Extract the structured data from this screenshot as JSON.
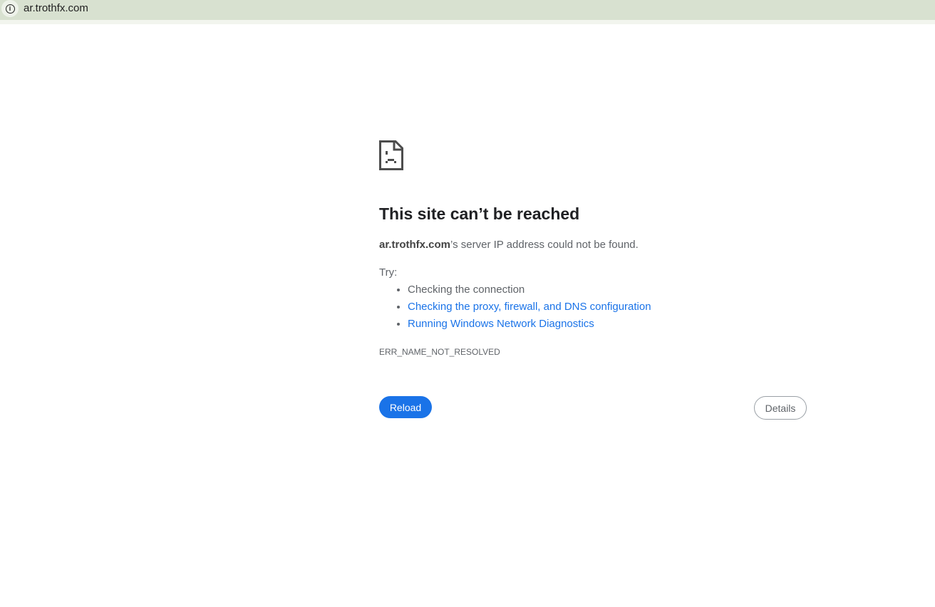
{
  "address_bar": {
    "url": "ar.trothfx.com",
    "icon": "info-icon"
  },
  "error": {
    "title": "This site can’t be reached",
    "host": "ar.trothfx.com",
    "message": "’s server IP address could not be found.",
    "try_label": "Try:",
    "suggestions": [
      {
        "text": "Checking the connection",
        "link": false
      },
      {
        "text": "Checking the proxy, firewall, and DNS configuration",
        "link": true
      },
      {
        "text": "Running Windows Network Diagnostics",
        "link": true
      }
    ],
    "code": "ERR_NAME_NOT_RESOLVED",
    "reload_label": "Reload",
    "details_label": "Details"
  }
}
